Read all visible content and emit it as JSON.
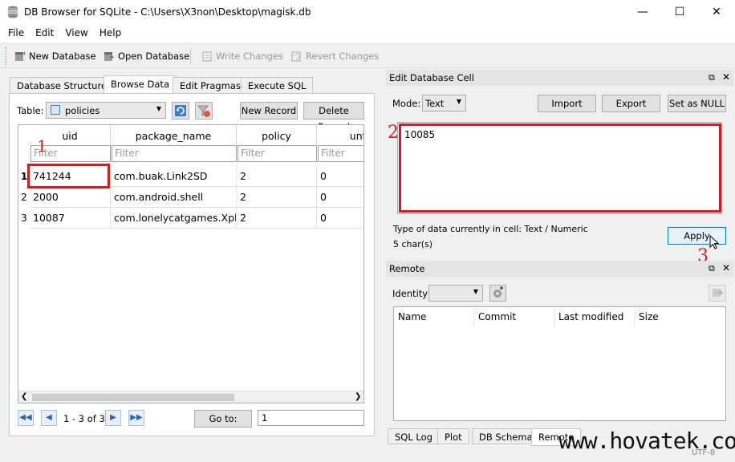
{
  "window": {
    "title": "DB Browser for SQLite - C:\\Users\\X3non\\Desktop\\magisk.db"
  },
  "menu": [
    "File",
    "Edit",
    "View",
    "Help"
  ],
  "toolbar": {
    "new_db": "New Database",
    "open_db": "Open Database",
    "write_changes": "Write Changes",
    "revert_changes": "Revert Changes"
  },
  "tabs": [
    "Database Structure",
    "Browse Data",
    "Edit Pragmas",
    "Execute SQL"
  ],
  "browse": {
    "table_label": "Table:",
    "table_value": "policies",
    "new_record": "New Record",
    "delete_record": "Delete Record",
    "columns": [
      "uid",
      "package_name",
      "policy",
      "unti"
    ],
    "filter_placeholder": "Filter",
    "rows": [
      {
        "num": "1",
        "uid": "741244",
        "package_name": "com.buak.Link2SD",
        "policy": "2",
        "until": "0"
      },
      {
        "num": "2",
        "uid": "2000",
        "package_name": "com.android.shell",
        "policy": "2",
        "until": "0"
      },
      {
        "num": "3",
        "uid": "10087",
        "package_name": "com.lonelycatgames.Xpl...",
        "policy": "2",
        "until": "0"
      }
    ],
    "pager": "1 - 3 of 3",
    "goto_label": "Go to:",
    "goto_value": "1"
  },
  "edit_cell": {
    "title": "Edit Database Cell",
    "mode_label": "Mode:",
    "mode_value": "Text",
    "import": "Import",
    "export": "Export",
    "set_null": "Set as NULL",
    "value": "10085",
    "type_info": "Type of data currently in cell: Text / Numeric",
    "size_info": "5 char(s)",
    "apply": "Apply"
  },
  "remote": {
    "title": "Remote",
    "identity_label": "Identity",
    "columns": [
      "Name",
      "Commit",
      "Last modified",
      "Size"
    ]
  },
  "bottom_tabs": [
    "SQL Log",
    "Plot",
    "DB Schema",
    "Remote"
  ],
  "annotations": {
    "one": "1",
    "two": "2",
    "three": "3"
  },
  "watermark": "www.hovatek.com",
  "status": "UTF-8"
}
